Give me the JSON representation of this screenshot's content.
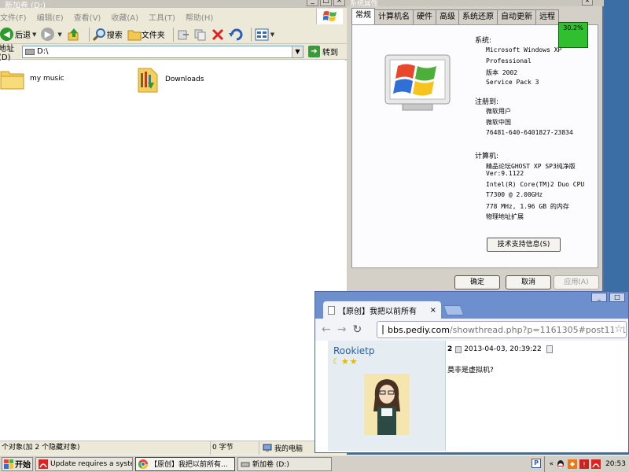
{
  "explorer": {
    "title": "新加卷 (D:)",
    "menu": [
      "文件(F)",
      "编辑(E)",
      "查看(V)",
      "收藏(A)",
      "工具(T)",
      "帮助(H)"
    ],
    "toolbar": {
      "back": "后退",
      "search": "搜索",
      "folders": "文件夹"
    },
    "address_label": "地址(D)",
    "address_value": "D:\\",
    "go_label": "转到",
    "files": [
      {
        "name": "my music"
      },
      {
        "name": "Downloads"
      }
    ],
    "status": {
      "objects": "个对象(加 2 个隐藏对象)",
      "size": "0 字节",
      "location": "我的电脑"
    }
  },
  "sysprop": {
    "title": "系统属性",
    "tabs": [
      "常规",
      "计算机名",
      "硬件",
      "高级",
      "系统还原",
      "自动更新",
      "远程"
    ],
    "perf_meter": "30.2%",
    "system_heading": "系统:",
    "system_lines": [
      "Microsoft Windows XP",
      "Professional",
      "版本 2002",
      "Service Pack 3"
    ],
    "registered_heading": "注册到:",
    "registered_lines": [
      "微软用户",
      "微软中国",
      "76481-640-6401827-23834"
    ],
    "computer_heading": "计算机:",
    "computer_lines": [
      "精品论坛GHOST XP SP3纯净版",
      "Ver:9.1122",
      "Intel(R) Core(TM)2 Duo CPU",
      "  T7300  @ 2.00GHz",
      "778 MHz, 1.96 GB 的内存",
      "物理地址扩展"
    ],
    "support_button": "技术支持信息(S)",
    "ok_button": "确定",
    "cancel_button": "取消",
    "apply_button": "应用(A)"
  },
  "chrome": {
    "tab_title": "【原创】我把以前所有",
    "url_host": "bbs.pediy.com",
    "url_path": "/showthread.php?p=1161305#post11613",
    "post": {
      "username": "Rookietp",
      "stars": "☾★★",
      "number": "2",
      "timestamp": "2013-04-03, 20:39:22",
      "text": "莫非是虚拟机?"
    }
  },
  "taskbar": {
    "start_label": "开始",
    "tasks": [
      {
        "label": "Update requires a syste..."
      },
      {
        "label": "【原创】我把以前所有..."
      },
      {
        "label": "新加卷 (D:)"
      }
    ],
    "tray_chevron": "«",
    "clock": "20:53"
  },
  "colors": {
    "desktop": "#3a6ea5",
    "chrome_frame": "#6d8fce",
    "perf_green": "#2fbf2f",
    "link_blue": "#2b5f9c"
  }
}
